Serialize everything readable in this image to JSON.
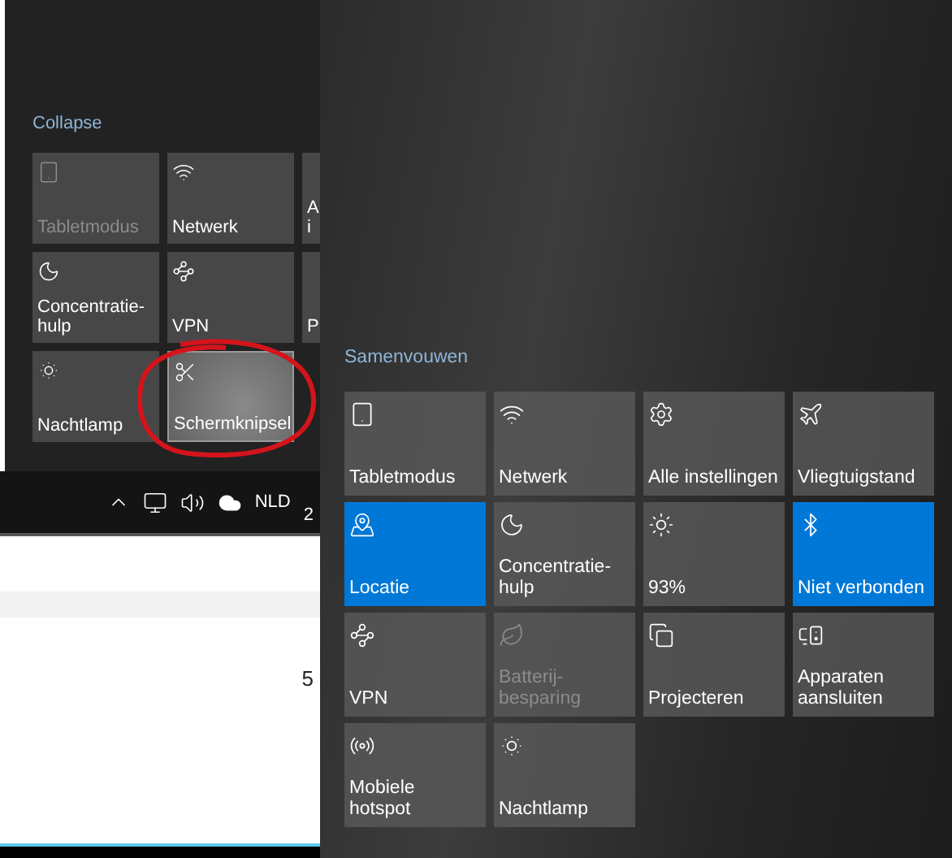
{
  "left_panel": {
    "collapse_link": "Collapse",
    "tiles": [
      {
        "lines": [
          "Tabletmodus"
        ],
        "on": false,
        "disabled": true,
        "highlighted": false,
        "annotated": false
      },
      {
        "lines": [
          "Netwerk"
        ],
        "on": false,
        "disabled": false,
        "highlighted": false,
        "annotated": false
      },
      {
        "lines": [
          "A",
          "i"
        ],
        "on": false,
        "disabled": false,
        "highlighted": false,
        "annotated": false
      },
      {
        "lines": [
          "Concentratie-",
          "hulp"
        ],
        "on": false,
        "disabled": false,
        "highlighted": false,
        "annotated": false
      },
      {
        "lines": [
          "VPN"
        ],
        "on": false,
        "disabled": false,
        "highlighted": false,
        "annotated": false
      },
      {
        "lines": [
          "P"
        ],
        "on": false,
        "disabled": false,
        "highlighted": false,
        "annotated": false
      },
      {
        "lines": [
          "Nachtlamp"
        ],
        "on": false,
        "disabled": false,
        "highlighted": false,
        "annotated": false
      },
      {
        "lines": [
          "Schermknipsel"
        ],
        "on": false,
        "disabled": false,
        "highlighted": true,
        "annotated": true
      }
    ]
  },
  "taskbar": {
    "language": "NLD",
    "clock": "2"
  },
  "document": {
    "cell": "5"
  },
  "right_panel": {
    "collapse_link": "Samenvouwen",
    "tiles": [
      {
        "lines": [
          "Tabletmodus"
        ],
        "on": false,
        "disabled": false
      },
      {
        "lines": [
          "Netwerk"
        ],
        "on": false,
        "disabled": false
      },
      {
        "lines": [
          "Alle instellingen"
        ],
        "on": false,
        "disabled": false
      },
      {
        "lines": [
          "Vliegtuigstand"
        ],
        "on": false,
        "disabled": false
      },
      {
        "lines": [
          "Locatie"
        ],
        "on": true,
        "disabled": false
      },
      {
        "lines": [
          "Concentratie-",
          "hulp"
        ],
        "on": false,
        "disabled": false
      },
      {
        "lines": [
          "93%"
        ],
        "on": false,
        "disabled": false
      },
      {
        "lines": [
          "Niet verbonden"
        ],
        "on": true,
        "disabled": false
      },
      {
        "lines": [
          "VPN"
        ],
        "on": false,
        "disabled": false
      },
      {
        "lines": [
          "Batterij-",
          "besparing"
        ],
        "on": false,
        "disabled": true
      },
      {
        "lines": [
          "Projecteren"
        ],
        "on": false,
        "disabled": false
      },
      {
        "lines": [
          "Apparaten",
          "aansluiten"
        ],
        "on": false,
        "disabled": false
      },
      {
        "lines": [
          "Mobiele",
          "hotspot"
        ],
        "on": false,
        "disabled": false
      },
      {
        "lines": [
          "Nachtlamp"
        ],
        "on": false,
        "disabled": false
      }
    ]
  }
}
